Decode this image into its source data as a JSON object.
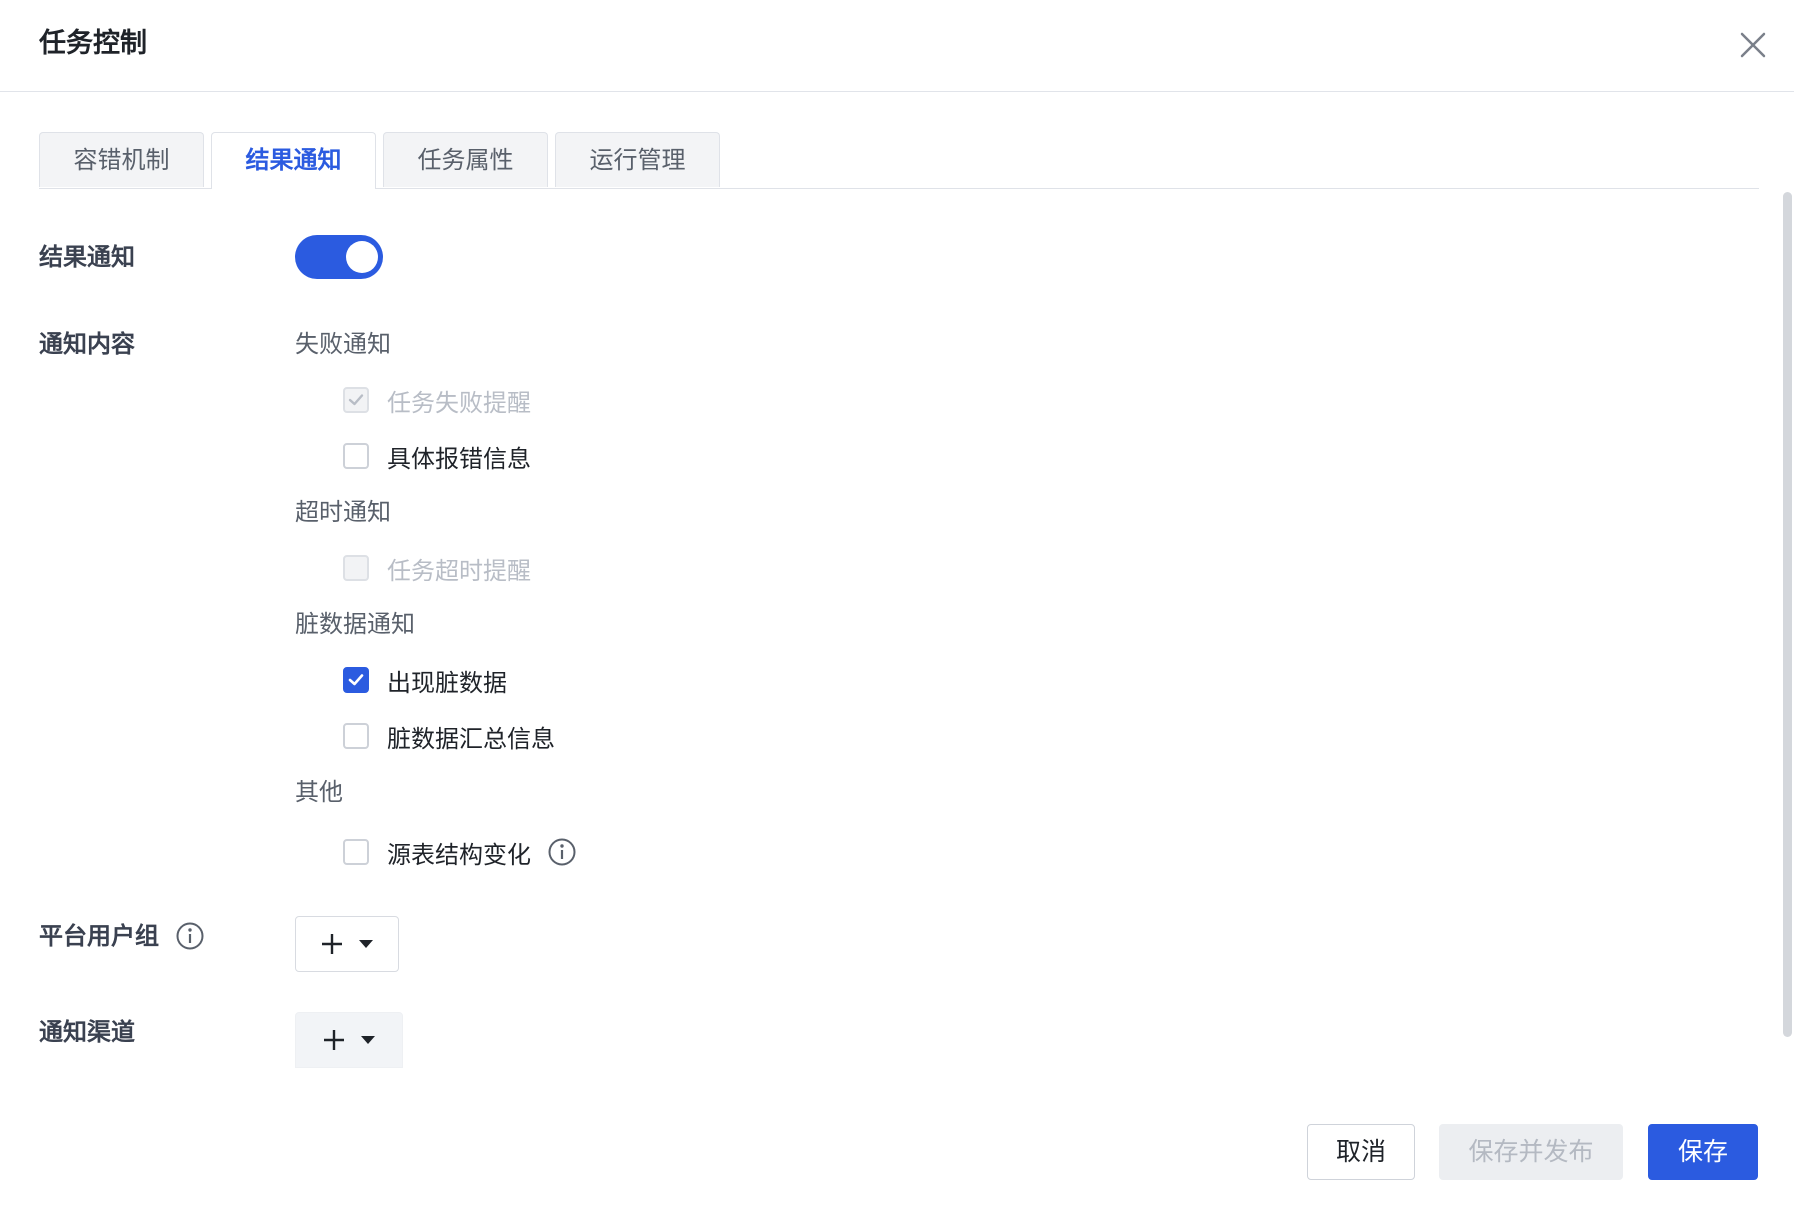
{
  "dialog": {
    "title": "任务控制"
  },
  "tabs": [
    {
      "label": "容错机制",
      "active": false
    },
    {
      "label": "结果通知",
      "active": true
    },
    {
      "label": "任务属性",
      "active": false
    },
    {
      "label": "运行管理",
      "active": false
    }
  ],
  "form": {
    "notify_label": "结果通知",
    "notify_enabled": true,
    "content_label": "通知内容",
    "groups": [
      {
        "title": "失败通知",
        "options": [
          {
            "label": "任务失败提醒",
            "checked": true,
            "disabled": true
          },
          {
            "label": "具体报错信息",
            "checked": false,
            "disabled": false
          }
        ]
      },
      {
        "title": "超时通知",
        "options": [
          {
            "label": "任务超时提醒",
            "checked": false,
            "disabled": true
          }
        ]
      },
      {
        "title": "脏数据通知",
        "options": [
          {
            "label": "出现脏数据",
            "checked": true,
            "disabled": false
          },
          {
            "label": "脏数据汇总信息",
            "checked": false,
            "disabled": false
          }
        ]
      },
      {
        "title": "其他",
        "options": [
          {
            "label": "源表结构变化",
            "checked": false,
            "disabled": false
          }
        ]
      }
    ],
    "user_group_label": "平台用户组",
    "channel_label": "通知渠道"
  },
  "footer": {
    "cancel": "取消",
    "save_publish": "保存并发布",
    "save": "保存"
  },
  "colors": {
    "primary": "#2b5be0",
    "disabled_text": "#b8bdc6"
  },
  "icons": [
    "close-icon",
    "check-icon",
    "info-icon",
    "plus-icon",
    "caret-down-icon"
  ]
}
